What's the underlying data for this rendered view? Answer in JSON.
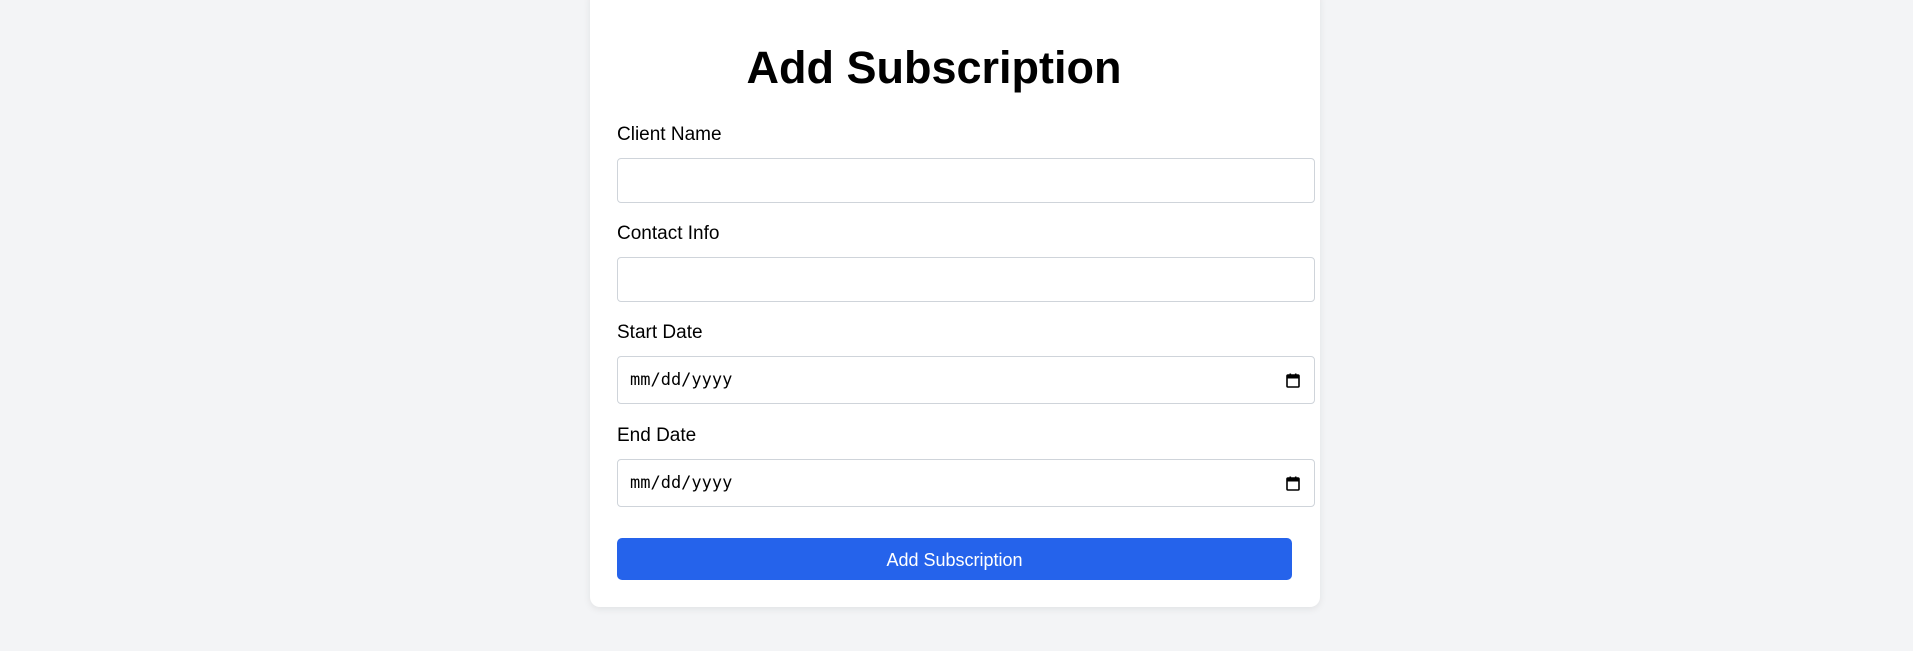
{
  "form": {
    "title": "Add Subscription",
    "client_name": {
      "label": "Client Name",
      "value": "",
      "placeholder": ""
    },
    "contact_info": {
      "label": "Contact Info",
      "value": "",
      "placeholder": ""
    },
    "start_date": {
      "label": "Start Date",
      "placeholder": "mm/dd/yyyy"
    },
    "end_date": {
      "label": "End Date",
      "placeholder": "mm/dd/yyyy"
    },
    "submit_label": "Add Subscription"
  },
  "colors": {
    "page_background": "#f3f4f6",
    "card_background": "#ffffff",
    "primary_button": "#2563eb",
    "input_border": "#cfd4da"
  },
  "icons": {
    "date_picker": "calendar-icon"
  }
}
